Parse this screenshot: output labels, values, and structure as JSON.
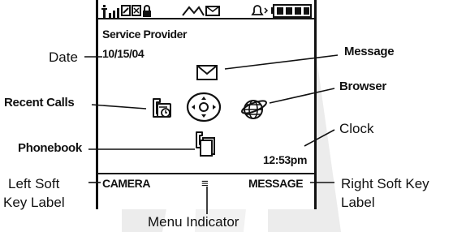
{
  "status_bar": {
    "signal_icon": "signal-strength-icon",
    "indicators": [
      "gprs-icon",
      "roam-icon",
      "lock-icon",
      "line-icon",
      "message-waiting-icon",
      "ring-style-icon",
      "battery-icon"
    ]
  },
  "screen": {
    "provider": "Service Provider",
    "date": "10/15/04",
    "clock": "12:53pm",
    "left_soft_key": "CAMERA",
    "right_soft_key": "MESSAGE",
    "menu_indicator_glyph": "≡"
  },
  "callouts": {
    "date": "Date",
    "message": "Message",
    "recent_calls": "Recent Calls",
    "browser": "Browser",
    "phonebook": "Phonebook",
    "clock": "Clock",
    "left_soft_key_line1": "Left Soft",
    "left_soft_key_line2": "Key Label",
    "right_soft_key_line1": "Right Soft Key",
    "right_soft_key_line2": "Label",
    "menu_indicator": "Menu Indicator"
  },
  "icons": {
    "message": "envelope-icon",
    "recent_calls": "recent-calls-icon",
    "nav_key": "navigation-key-icon",
    "browser": "globe-icon",
    "phonebook": "phonebook-icon"
  },
  "colors": {
    "ink": "#111111",
    "background_shape": "#e9e9e9"
  }
}
